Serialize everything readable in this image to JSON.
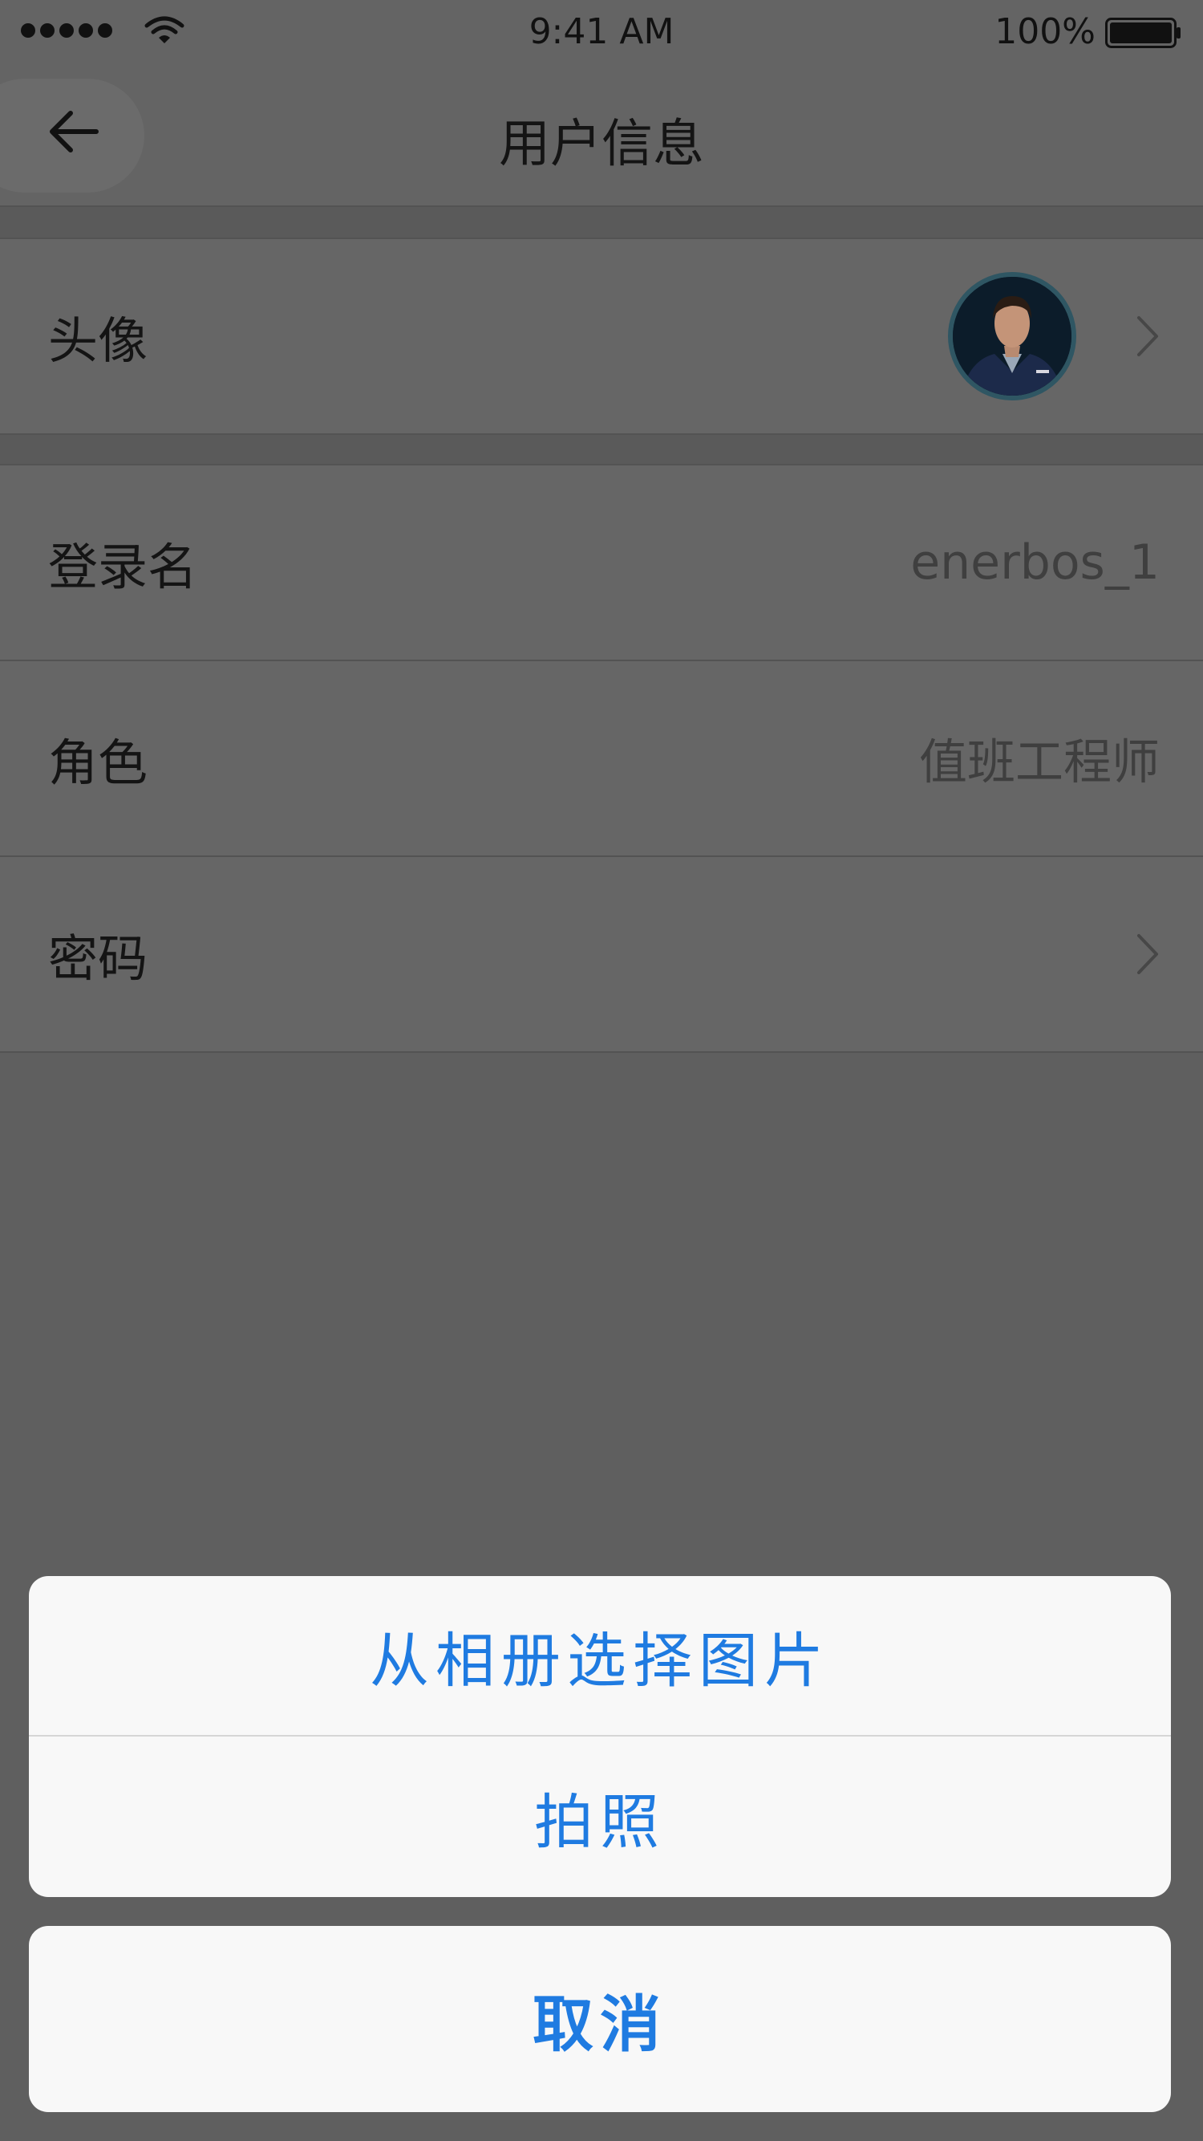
{
  "status_bar": {
    "time": "9:41 AM",
    "battery": "100%",
    "icons": [
      "signal-dots-icon",
      "wifi-icon",
      "battery-icon"
    ]
  },
  "nav": {
    "title": "用户信息",
    "back_icon": "arrow-left-icon"
  },
  "rows": {
    "avatar": {
      "label": "头像"
    },
    "login": {
      "label": "登录名",
      "value": "enerbos_1"
    },
    "role": {
      "label": "角色",
      "value": "值班工程师"
    },
    "password": {
      "label": "密码"
    }
  },
  "action_sheet": {
    "choose_album": "从相册选择图片",
    "take_photo": "拍照",
    "cancel": "取消"
  },
  "colors": {
    "overlay": "#5f5f5f",
    "accent": "#1f7be1",
    "sheet_bg": "#f8f8f8"
  }
}
